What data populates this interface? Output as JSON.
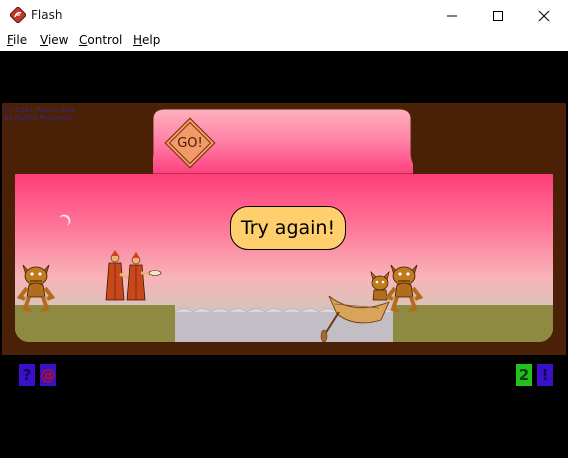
{
  "window": {
    "title": "Flash",
    "minimize_icon": "minimize-icon",
    "maximize_icon": "maximize-icon",
    "close_icon": "close-icon"
  },
  "menu": {
    "items": [
      {
        "accel": "F",
        "rest": "ile"
      },
      {
        "accel": "V",
        "rest": "iew"
      },
      {
        "accel": "C",
        "rest": "ontrol"
      },
      {
        "accel": "H",
        "rest": "elp"
      }
    ]
  },
  "game": {
    "go_button_label": "GO!",
    "message": "Try again!",
    "credit_line1": "(c) 2001 Plastic Arts",
    "credit_line2": "All Rights Reserved",
    "hud": {
      "help_label": "?",
      "at_label": "@",
      "counter_label": "2",
      "info_label": "!"
    },
    "colors": {
      "frame_brown": "#4a2006",
      "sky_top": "#ff3d7a",
      "ground_olive": "#8f8a42",
      "water": "#c3bdc6",
      "bubble_fill": "#ffcf6e",
      "go_fill": "#f39a6a",
      "hud_blue": "#3a10c8",
      "hud_green": "#22c21a"
    },
    "characters": [
      "devil-left",
      "monk-1",
      "monk-2",
      "devil-boat",
      "devil-right"
    ],
    "props": [
      "boat",
      "moon"
    ]
  }
}
